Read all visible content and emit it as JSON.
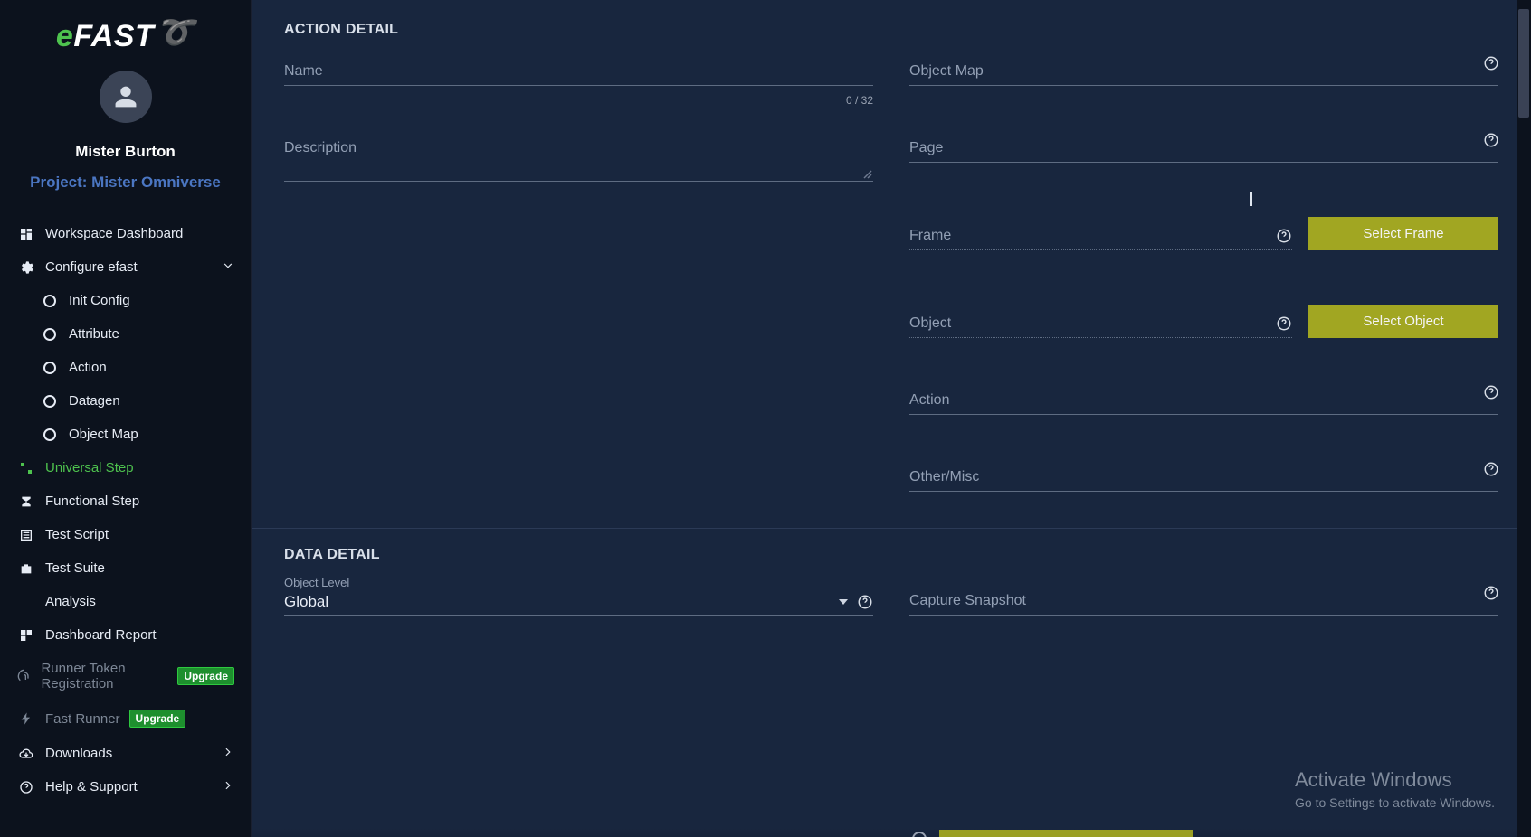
{
  "brand": {
    "e": "e",
    "rest": "FAST"
  },
  "user": {
    "name": "Mister Burton",
    "project_label": "Project: Mister Omniverse"
  },
  "sidebar": {
    "workspace": "Workspace Dashboard",
    "configure": "Configure efast",
    "children": {
      "init": "Init Config",
      "attribute": "Attribute",
      "action": "Action",
      "datagen": "Datagen",
      "objectmap": "Object Map"
    },
    "universal": "Universal Step",
    "functional": "Functional Step",
    "testscript": "Test Script",
    "testsuite": "Test Suite",
    "analysis": "Analysis",
    "dashboardreport": "Dashboard Report",
    "runnertoken": "Runner Token Registration",
    "fastrunner": "Fast Runner",
    "upgrade": "Upgrade",
    "downloads": "Downloads",
    "help": "Help & Support"
  },
  "section": {
    "action_detail": "ACTION DETAIL",
    "data_detail": "DATA DETAIL"
  },
  "fields": {
    "name": "Name",
    "name_counter": "0 / 32",
    "description": "Description",
    "objectmap": "Object Map",
    "page": "Page",
    "frame": "Frame",
    "object": "Object",
    "action": "Action",
    "othermisc": "Other/Misc",
    "object_level_label": "Object Level",
    "object_level_value": "Global",
    "capture_snapshot": "Capture Snapshot"
  },
  "buttons": {
    "select_frame": "Select Frame",
    "select_object": "Select Object"
  },
  "watermark": {
    "line1": "Activate Windows",
    "line2": "Go to Settings to activate Windows."
  }
}
